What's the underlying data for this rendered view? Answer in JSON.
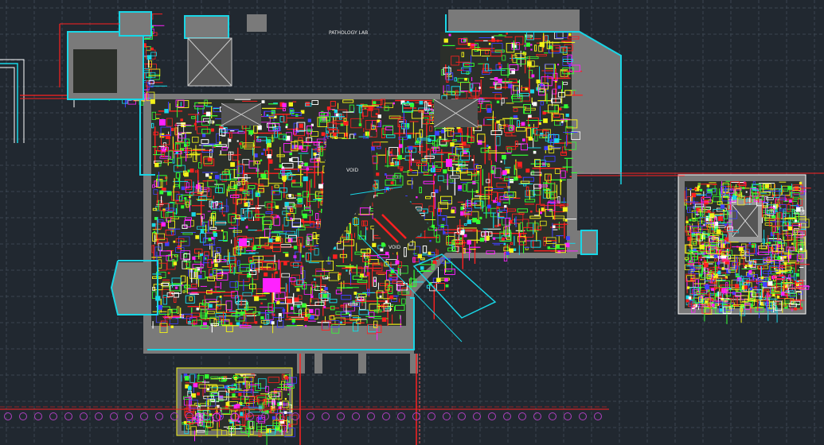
{
  "viewport": {
    "label": "CAD model space viewport"
  },
  "labels": {
    "pathology_lab": "PATHOLOGY LAB",
    "void": "VOID"
  },
  "colors": {
    "background": "#212830",
    "grid": "#3a4450",
    "wall": "#7a7a7a",
    "outline_cyan": "#19d6e6",
    "red": "#ff2020",
    "yellow": "#f2f21a",
    "green": "#33ff33",
    "magenta": "#ff22ff",
    "white": "#ffffff",
    "blue": "#4040ff"
  }
}
